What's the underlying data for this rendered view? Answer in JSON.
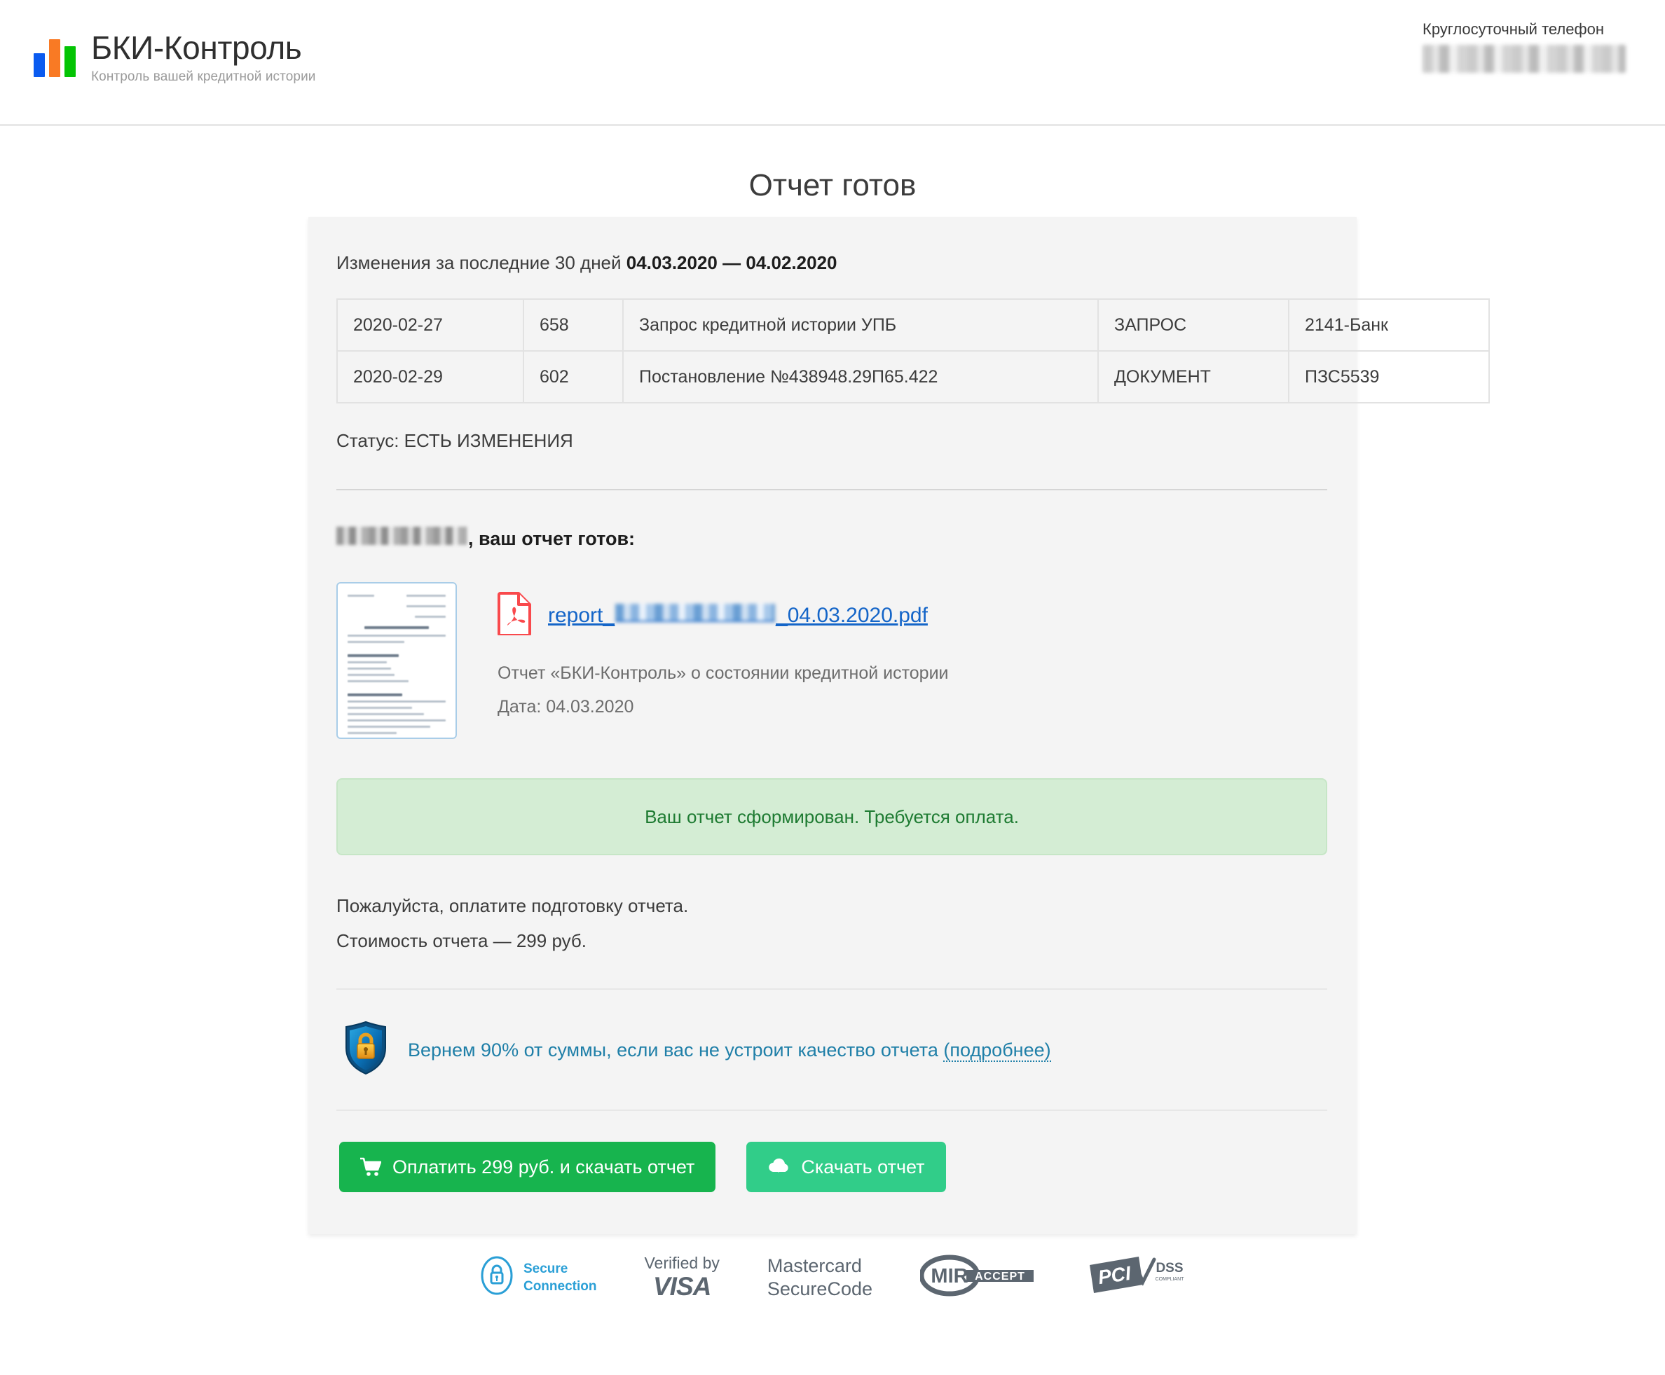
{
  "header": {
    "brand_title": "БКИ-Контроль",
    "brand_subtitle": "Контроль вашей кредитной истории",
    "phone_label": "Круглосуточный телефон",
    "phone_value_redacted": ""
  },
  "page": {
    "title": "Отчет готов"
  },
  "changes": {
    "intro_prefix": "Изменения за последние 30 дней ",
    "date_from": "04.03.2020",
    "date_separator": " — ",
    "date_to": "04.02.2020",
    "rows": [
      {
        "date": "2020-02-27",
        "code": "658",
        "description": "Запрос кредитной истории УПБ",
        "type": "ЗАПРОС",
        "source": "2141-Банк"
      },
      {
        "date": "2020-02-29",
        "code": "602",
        "description": "Постановление №438948.29П65.422",
        "type": "ДОКУМЕНТ",
        "source": "ПЗС5539"
      }
    ],
    "status": "Статус: ЕСТЬ ИЗМЕНЕНИЯ"
  },
  "greeting": {
    "name_redacted": "",
    "text": ", ваш отчет готов:"
  },
  "report": {
    "file_prefix": "report_",
    "file_name_redacted": "",
    "file_suffix": "_04.03.2020.pdf",
    "description": "Отчет «БКИ-Контроль» о состоянии кредитной истории",
    "date": "Дата: 04.03.2020",
    "thumbnail_alt": "Превью отчета PDF"
  },
  "alert": {
    "message": "Ваш отчет сформирован. Требуется оплата.",
    "background": "#d4edd4",
    "color": "#1e7b32"
  },
  "payment": {
    "note": "Пожалуйста, оплатите подготовку отчета.",
    "price_line": "Стоимость отчета — 299 руб."
  },
  "guarantee": {
    "text": "Вернем 90% от суммы, если вас не устроит качество отчета ",
    "link": "(подробнее)",
    "color": "#1f7fa8"
  },
  "actions": {
    "pay_label": "Оплатить 299 руб. и скачать отчет",
    "download_label": "Скачать отчет",
    "pay_color": "#17b44e",
    "download_color": "#31cd89"
  },
  "badges": {
    "secure_line1": "Secure",
    "secure_line2": "Connection",
    "visa_top": "Verified by",
    "visa_word": "VISA",
    "mastercard_line1": "Mastercard",
    "mastercard_line2": "SecureCode",
    "mir_text": "MIR",
    "mir_accept": "ACCEPT",
    "pci_text": "PCI",
    "pci_dss": "DSS",
    "pci_sub": "COMPLIANT"
  }
}
